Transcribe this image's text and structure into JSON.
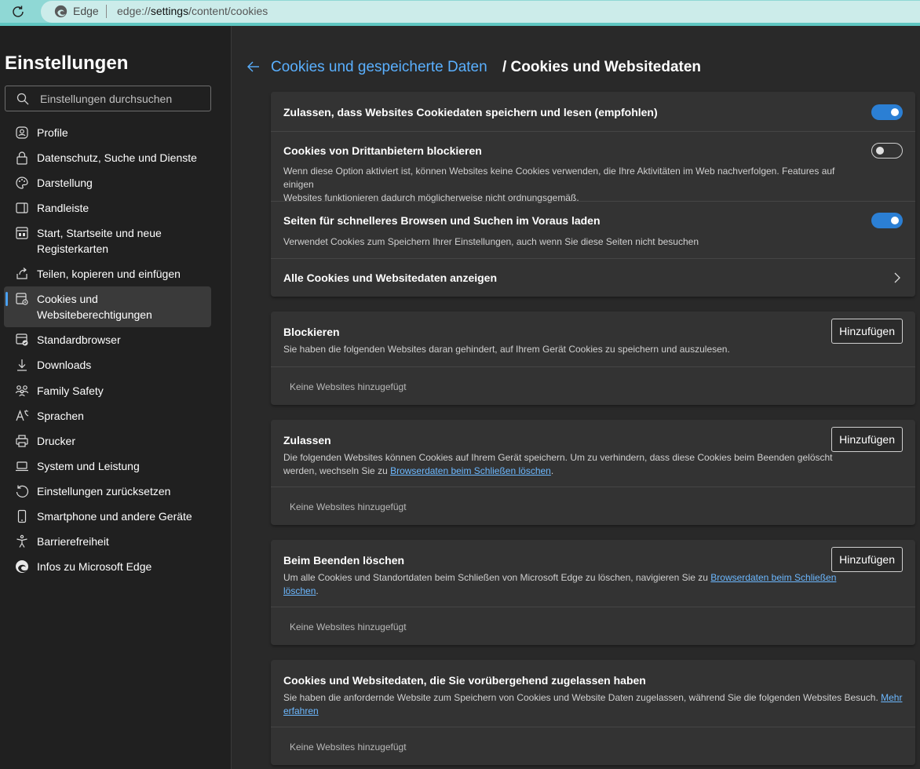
{
  "address_bar": {
    "browser_label": "Edge",
    "url_prefix": "edge://",
    "url_host": "settings",
    "url_path": "/content/cookies"
  },
  "icons": {
    "reload": "reload-icon",
    "edge": "edge-logo-icon",
    "back": "back-arrow-icon"
  },
  "sidebar": {
    "title": "Einstellungen",
    "search_placeholder": "Einstellungen durchsuchen",
    "items": [
      {
        "label": "Profile",
        "icon": "profile-icon"
      },
      {
        "label": "Datenschutz, Suche und Dienste",
        "icon": "lock-icon"
      },
      {
        "label": "Darstellung",
        "icon": "palette-icon"
      },
      {
        "label": "Randleiste",
        "icon": "sidebar-icon"
      },
      {
        "label": "Start, Startseite und neue Registerkarten",
        "icon": "home-icon"
      },
      {
        "label": "Teilen, kopieren und einfügen",
        "icon": "share-icon"
      },
      {
        "label": "Cookies und Websiteberechtigungen",
        "icon": "cookie-permissions-icon",
        "active": true
      },
      {
        "label": "Standardbrowser",
        "icon": "default-browser-icon"
      },
      {
        "label": "Downloads",
        "icon": "download-icon"
      },
      {
        "label": "Family Safety",
        "icon": "family-icon"
      },
      {
        "label": "Sprachen",
        "icon": "language-icon"
      },
      {
        "label": "Drucker",
        "icon": "printer-icon"
      },
      {
        "label": "System und Leistung",
        "icon": "laptop-icon"
      },
      {
        "label": "Einstellungen zurücksetzen",
        "icon": "reset-icon"
      },
      {
        "label": "Smartphone und andere Geräte",
        "icon": "phone-icon"
      },
      {
        "label": "Barrierefreiheit",
        "icon": "accessibility-icon"
      },
      {
        "label": "Infos zu Microsoft Edge",
        "icon": "edge-icon"
      }
    ]
  },
  "breadcrumb": {
    "parent": "Cookies und gespeicherte Daten",
    "current": "/ Cookies und Websitedaten"
  },
  "colors": {
    "accent": "#2b7fd4",
    "link": "#5ab0ff",
    "sidebar_bg": "#202020",
    "main_bg": "#292929",
    "card_bg": "#333333"
  },
  "settings_card": {
    "allow_cookies": {
      "title": "Zulassen, dass Websites Cookiedaten speichern und lesen (empfohlen)",
      "enabled": true
    },
    "block_third_party": {
      "title": "Cookies von Drittanbietern blockieren",
      "desc_line1": "Wenn diese Option aktiviert ist, können Websites keine Cookies verwenden, die Ihre Aktivitäten im Web nachverfolgen. Features auf einigen",
      "desc_line2": "Websites funktionieren dadurch möglicherweise nicht ordnungsgemäß.",
      "enabled": false
    },
    "preload": {
      "title": "Seiten für schnelleres Browsen und Suchen im Voraus laden",
      "desc": "Verwendet Cookies zum Speichern Ihrer Einstellungen, auch wenn Sie diese Seiten nicht besuchen",
      "enabled": true
    },
    "see_all": {
      "title": "Alle Cookies und Websitedaten anzeigen"
    }
  },
  "block_card": {
    "title": "Blockieren",
    "desc": "Sie haben die folgenden Websites daran gehindert, auf Ihrem Gerät Cookies zu speichern und auszulesen.",
    "button": "Hinzufügen",
    "empty": "Keine Websites hinzugefügt"
  },
  "allow_card": {
    "title": "Zulassen",
    "desc_line1": "Die folgenden Websites können Cookies auf Ihrem Gerät speichern. Um zu verhindern, dass diese Cookies beim Beenden gelöscht",
    "desc_line2_pre": "werden, wechseln Sie zu ",
    "desc_link": "Browserdaten beim Schließen löschen",
    "desc_line2_post": ".",
    "button": "Hinzufügen",
    "empty": "Keine Websites hinzugefügt"
  },
  "clear_on_exit_card": {
    "title": "Beim Beenden löschen",
    "desc_line1_pre": "Um alle Cookies und Standortdaten beim Schließen von Microsoft Edge zu löschen, navigieren Sie zu ",
    "desc_link_part1": "Browserdaten beim Schließen",
    "desc_link_part2": "löschen",
    "desc_line2_post": ".",
    "button": "Hinzufügen",
    "empty": "Keine Websites hinzugefügt"
  },
  "temporary_card": {
    "title": "Cookies und Websitedaten, die Sie vorübergehend zugelassen haben",
    "desc_line1_pre": "Sie haben die anfordernde Website zum Speichern von Cookies und Website Daten zugelassen, während Sie die folgenden Websites Besuch. ",
    "desc_link_part1": "Mehr",
    "desc_link_part2": "erfahren",
    "empty": "Keine Websites hinzugefügt"
  }
}
